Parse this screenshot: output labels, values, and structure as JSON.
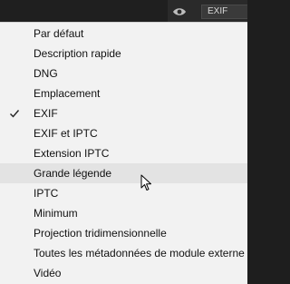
{
  "toolbar": {
    "metadata_preset": "EXIF",
    "visibility_icon": "eye-icon"
  },
  "menu": {
    "selected_item": "EXIF",
    "highlighted_item": "Grande légende",
    "items": [
      {
        "label": "Par défaut",
        "checked": false
      },
      {
        "label": "Description rapide",
        "checked": false
      },
      {
        "label": "DNG",
        "checked": false
      },
      {
        "label": "Emplacement",
        "checked": false
      },
      {
        "label": "EXIF",
        "checked": true
      },
      {
        "label": "EXIF et IPTC",
        "checked": false
      },
      {
        "label": "Extension IPTC",
        "checked": false
      },
      {
        "label": "Grande légende",
        "checked": false
      },
      {
        "label": "IPTC",
        "checked": false
      },
      {
        "label": "Minimum",
        "checked": false
      },
      {
        "label": "Projection tridimensionnelle",
        "checked": false
      },
      {
        "label": "Toutes les métadonnées de module externe",
        "checked": false
      },
      {
        "label": "Vidéo",
        "checked": false
      }
    ]
  }
}
